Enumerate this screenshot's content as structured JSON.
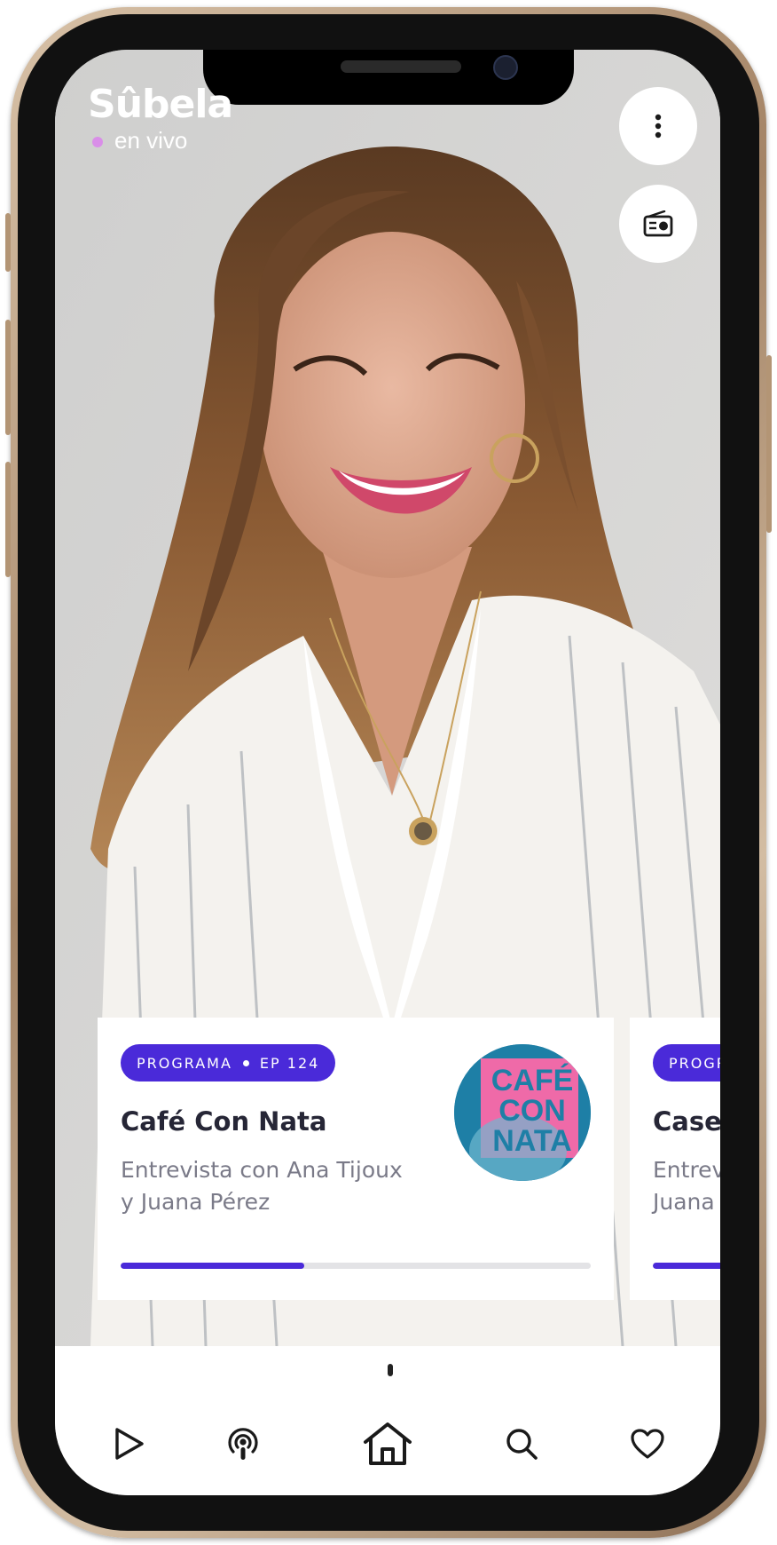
{
  "header": {
    "logo": "Sûbela",
    "live_label": "en vivo"
  },
  "actions": {
    "more_icon": "more-vertical-icon",
    "radio_icon": "radio-icon"
  },
  "cards": [
    {
      "type_label": "PROGRAMA",
      "episode_label": "EP 124",
      "title": "Café Con Nata",
      "description": "Entrevista con Ana Tijoux y Juana Pérez",
      "cover_text": [
        "CAFÉ",
        "CON",
        "NATA"
      ],
      "progress": 0.39
    },
    {
      "type_label": "PROGR",
      "title": "Caser",
      "description": "Entrev Juana",
      "progress": 0.5
    }
  ],
  "bottom_nav": [
    {
      "name": "play",
      "icon": "play-icon"
    },
    {
      "name": "podcasts",
      "icon": "podcast-icon"
    },
    {
      "name": "home",
      "icon": "home-icon",
      "active": true
    },
    {
      "name": "search",
      "icon": "search-icon"
    },
    {
      "name": "favorites",
      "icon": "heart-icon"
    }
  ],
  "colors": {
    "accent": "#4a2ad9",
    "live_dot": "#d98ee8",
    "cover_pink": "#ef6aa8",
    "cover_blue": "#1e7fa6"
  }
}
